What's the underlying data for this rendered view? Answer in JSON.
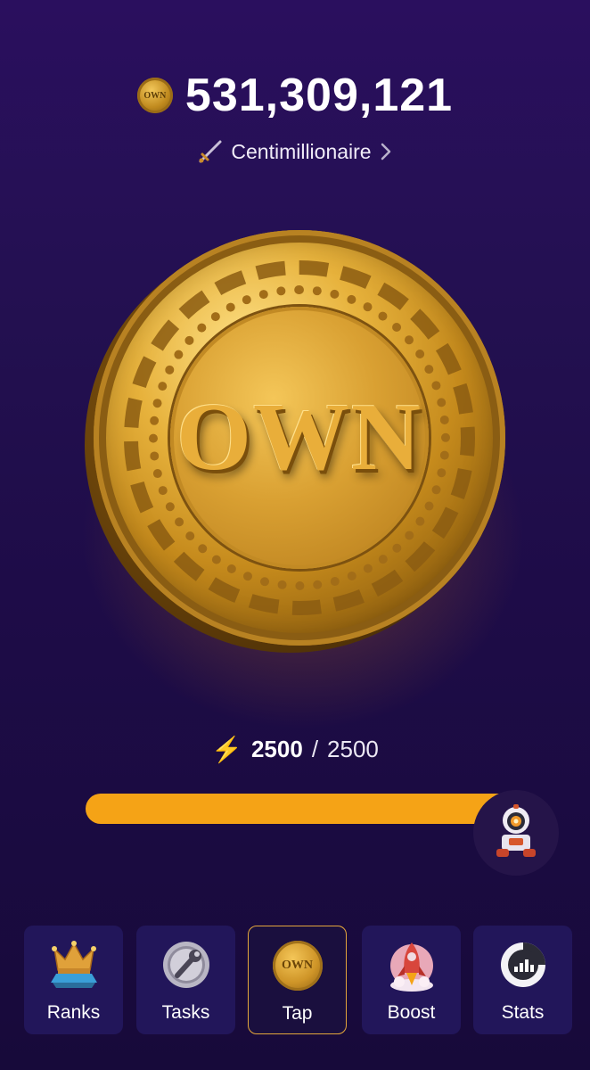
{
  "balance": {
    "value": "531,309,121",
    "coin_icon_text": "OWN"
  },
  "rank": {
    "title": "Centimillionaire"
  },
  "coin": {
    "label": "OWN"
  },
  "energy": {
    "current": "2500",
    "separator": "/",
    "max": "2500",
    "fraction": 1.0
  },
  "nav": {
    "items": [
      {
        "label": "Ranks",
        "icon": "crown-icon"
      },
      {
        "label": "Tasks",
        "icon": "wrench-icon"
      },
      {
        "label": "Tap",
        "icon": "own-coin-icon",
        "active": true,
        "icon_text": "OWN"
      },
      {
        "label": "Boost",
        "icon": "rocket-icon"
      },
      {
        "label": "Stats",
        "icon": "gamepad-chart-icon"
      }
    ]
  },
  "colors": {
    "accent": "#f5a316",
    "active_border": "#e3a63b",
    "background": "#231050"
  }
}
